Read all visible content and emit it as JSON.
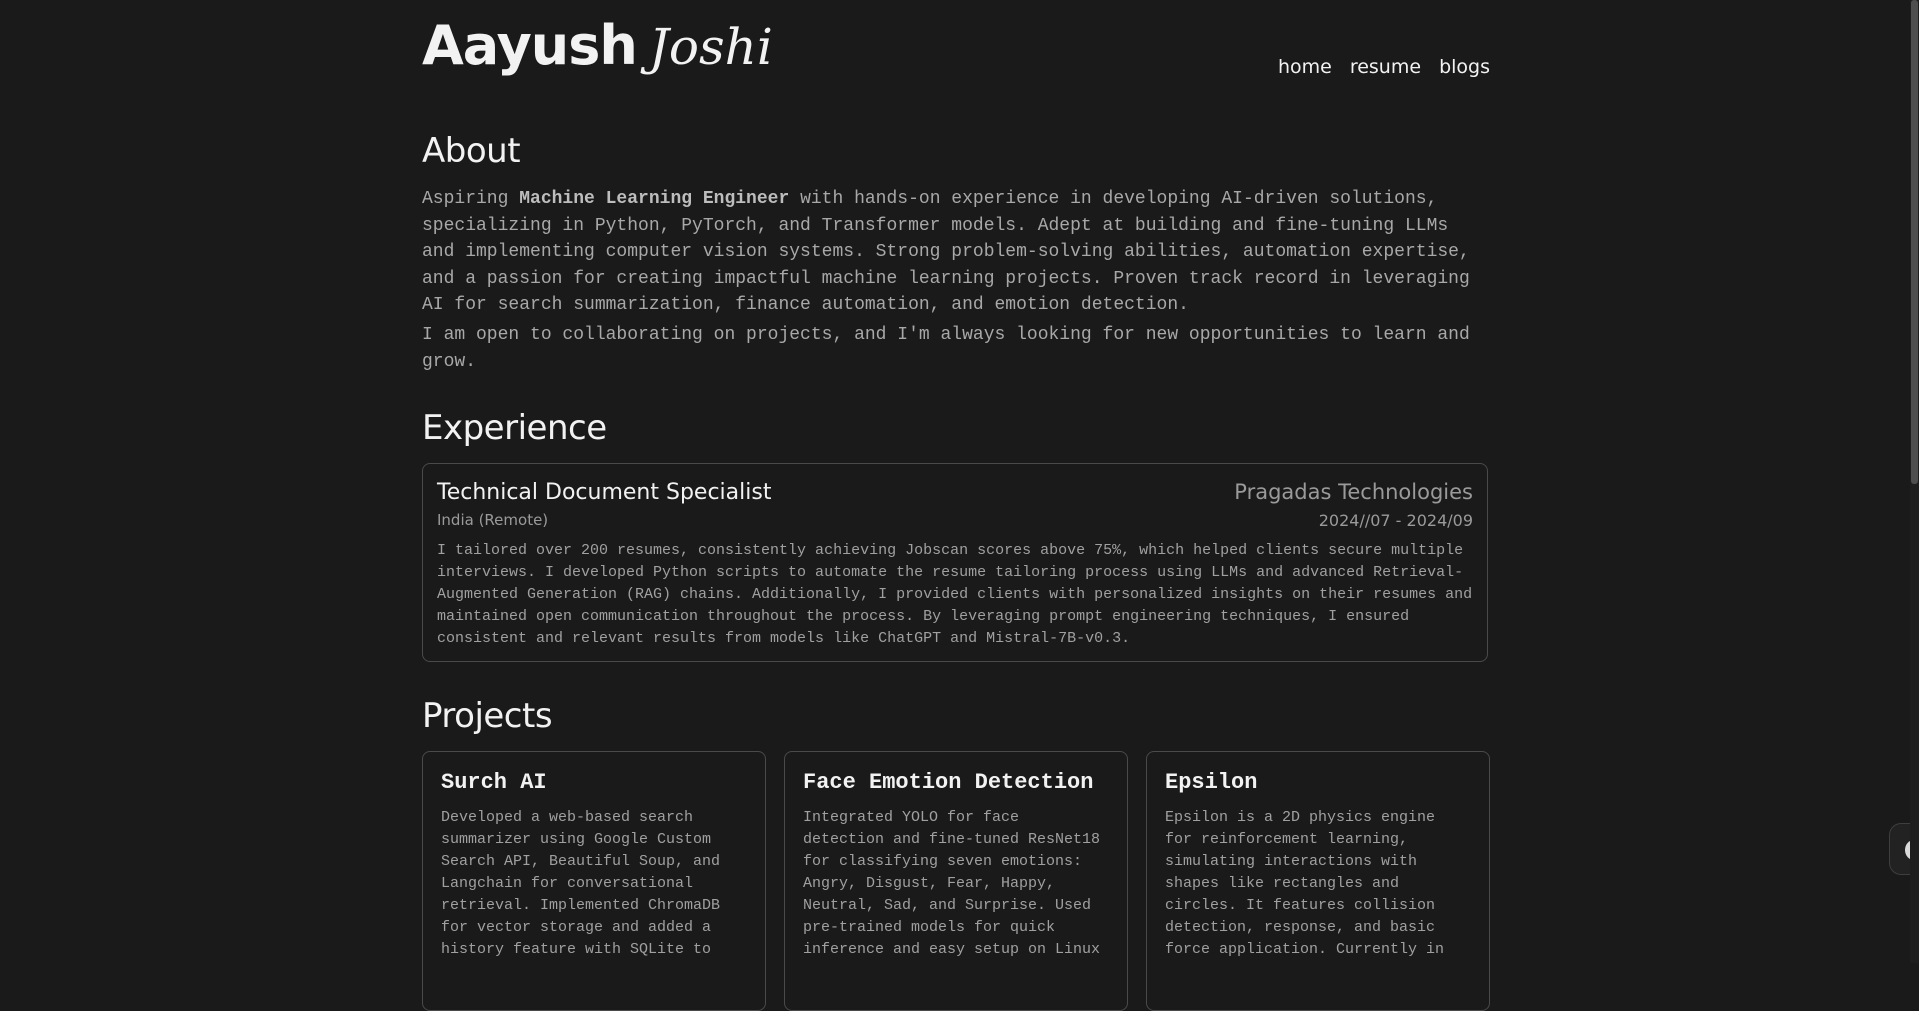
{
  "header": {
    "name_first": "Aayush",
    "name_last": "Joshi",
    "nav": [
      "home",
      "resume",
      "blogs"
    ]
  },
  "about": {
    "title": "About",
    "intro_prefix": "Aspiring ",
    "intro_bold": "Machine Learning Engineer",
    "intro_rest": " with hands-on experience in developing AI-driven solutions, specializing in Python, PyTorch, and Transformer models. Adept at building and fine-tuning LLMs and implementing computer vision systems. Strong problem-solving abilities, automation expertise, and a passion for creating impactful machine learning projects. Proven track record in leveraging AI for search summarization, finance automation, and emotion detection.",
    "paragraph2": "I am open to collaborating on projects, and I'm always looking for new opportunities to learn and grow."
  },
  "experience": {
    "title": "Experience",
    "items": [
      {
        "role": "Technical Document Specialist",
        "company": "Pragadas Technologies",
        "location": "India (Remote)",
        "dates": "2024//07 - 2024/09",
        "description": "I tailored over 200 resumes, consistently achieving Jobscan scores above 75%, which helped clients secure multiple interviews. I developed Python scripts to automate the resume tailoring process using LLMs and advanced Retrieval-Augmented Generation (RAG) chains. Additionally, I provided clients with personalized insights on their resumes and maintained open communication throughout the process. By leveraging prompt engineering techniques, I ensured consistent and relevant results from models like ChatGPT and Mistral-7B-v0.3."
      }
    ]
  },
  "projects": {
    "title": "Projects",
    "items": [
      {
        "name": "Surch AI",
        "description": "Developed a web-based search summarizer using Google Custom Search API, Beautiful Soup, and Langchain for conversational retrieval. Implemented ChromaDB for vector storage and added a history feature with SQLite to"
      },
      {
        "name": "Face Emotion Detection",
        "description": "Integrated YOLO for face detection and fine-tuned ResNet18 for classifying seven emotions: Angry, Disgust, Fear, Happy, Neutral, Sad, and Surprise. Used pre-trained models for quick inference and easy setup on Linux"
      },
      {
        "name": "Epsilon",
        "description": "Epsilon is a 2D physics engine for reinforcement learning, simulating interactions with shapes like rectangles and circles. It features collision detection, response, and basic force application. Currently in"
      }
    ]
  }
}
